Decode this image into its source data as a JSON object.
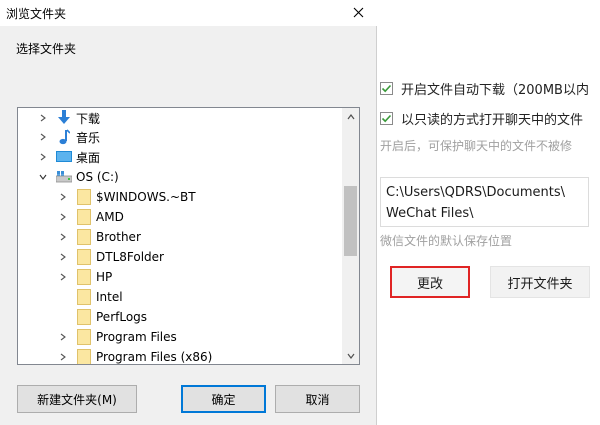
{
  "settings": {
    "auto_download_label": "开启文件自动下载（200MB以内",
    "readonly_label": "以只读的方式打开聊天中的文件",
    "readonly_hint": "开启后，可保护聊天中的文件不被修",
    "path_value": "C:\\Users\\QDRS\\Documents\\\nWeChat Files\\",
    "path_hint": "微信文件的默认保存位置",
    "change_label": "更改",
    "open_folder_label": "打开文件夹"
  },
  "dialog": {
    "title": "浏览文件夹",
    "prompt": "选择文件夹",
    "tree": {
      "downloads": "下载",
      "music": "音乐",
      "desktop": "桌面",
      "drive": "OS (C:)",
      "folders": [
        "$WINDOWS.~BT",
        "AMD",
        "Brother",
        "DTL8Folder",
        "HP",
        "Intel",
        "PerfLogs",
        "Program Files",
        "Program Files (x86)"
      ]
    },
    "new_folder_label": "新建文件夹(M)",
    "ok_label": "确定",
    "cancel_label": "取消"
  },
  "colors": {
    "accent": "#0078d7",
    "highlight": "#e02424",
    "folder": "#fbe7a1"
  }
}
